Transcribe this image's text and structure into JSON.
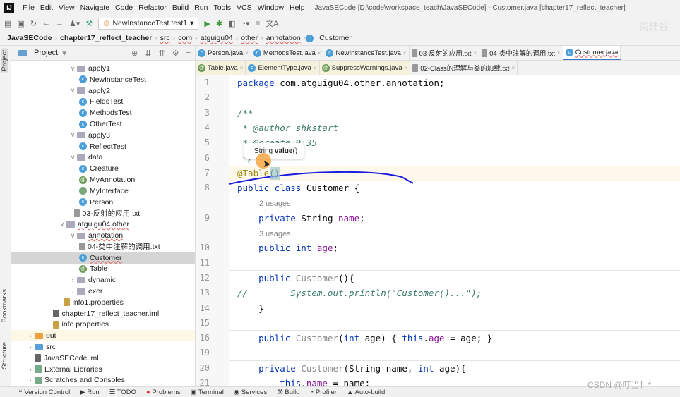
{
  "menubar": {
    "items": [
      "File",
      "Edit",
      "View",
      "Navigate",
      "Code",
      "Refactor",
      "Build",
      "Run",
      "Tools",
      "VCS",
      "Window",
      "Help"
    ],
    "title": "JavaSECode [D:\\code\\workspace_teach\\JavaSECode] - Customer.java [chapter17_reflect_teacher]"
  },
  "toolbar": {
    "run_config": "NewInstanceTest.test1"
  },
  "breadcrumb": [
    "JavaSECode",
    "chapter17_reflect_teacher",
    "src",
    "com",
    "atguigu04",
    "other",
    "annotation",
    "Customer"
  ],
  "left_strip": {
    "project": "Project",
    "bookmarks": "Bookmarks",
    "structure": "Structure"
  },
  "project": {
    "title": "Project",
    "tree": [
      {
        "label": "apply1",
        "lvl": 5,
        "type": "folder",
        "open": true
      },
      {
        "label": "NewInstanceTest",
        "lvl": 6,
        "type": "cls"
      },
      {
        "label": "apply2",
        "lvl": 5,
        "type": "folder",
        "open": true
      },
      {
        "label": "FieldsTest",
        "lvl": 6,
        "type": "cls"
      },
      {
        "label": "MethodsTest",
        "lvl": 6,
        "type": "cls"
      },
      {
        "label": "OtherTest",
        "lvl": 6,
        "type": "cls"
      },
      {
        "label": "apply3",
        "lvl": 5,
        "type": "folder",
        "open": true
      },
      {
        "label": "ReflectTest",
        "lvl": 6,
        "type": "cls"
      },
      {
        "label": "data",
        "lvl": 5,
        "type": "folder",
        "open": true
      },
      {
        "label": "Creature",
        "lvl": 6,
        "type": "cls"
      },
      {
        "label": "MyAnnotation",
        "lvl": 6,
        "type": "ann"
      },
      {
        "label": "MyInterface",
        "lvl": 6,
        "type": "itf"
      },
      {
        "label": "Person",
        "lvl": 6,
        "type": "cls"
      },
      {
        "label": "03-反射的应用.txt",
        "lvl": 5.5,
        "type": "txt"
      },
      {
        "label": "atguigu04.other",
        "lvl": 4,
        "type": "folder",
        "open": true
      },
      {
        "label": "annotation",
        "lvl": 5,
        "type": "folder",
        "open": true
      },
      {
        "label": "04-类中注解的调用.txt",
        "lvl": 6,
        "type": "txt"
      },
      {
        "label": "Customer",
        "lvl": 6,
        "type": "cls",
        "selected": true
      },
      {
        "label": "Table",
        "lvl": 6,
        "type": "ann"
      },
      {
        "label": "dynamic",
        "lvl": 5,
        "type": "folder",
        "open": false
      },
      {
        "label": "exer",
        "lvl": 5,
        "type": "folder",
        "open": false
      },
      {
        "label": "info1.properties",
        "lvl": 4.5,
        "type": "prop"
      },
      {
        "label": "chapter17_reflect_teacher.iml",
        "lvl": 3.5,
        "type": "iml"
      },
      {
        "label": "info.properties",
        "lvl": 3.5,
        "type": "prop"
      },
      {
        "label": "out",
        "lvl": 1,
        "type": "folder-o",
        "open": false,
        "hl": true
      },
      {
        "label": "src",
        "lvl": 1,
        "type": "folder-b",
        "open": false
      },
      {
        "label": "JavaSECode.iml",
        "lvl": 1.8,
        "type": "iml"
      },
      {
        "label": "External Libraries",
        "lvl": 1,
        "type": "lib",
        "open": false
      },
      {
        "label": "Scratches and Consoles",
        "lvl": 1,
        "type": "lib",
        "open": false
      }
    ]
  },
  "tabs_row1": [
    {
      "label": "Person.java",
      "icon": "cls"
    },
    {
      "label": "MethodsTest.java",
      "icon": "cls"
    },
    {
      "label": "NewInstanceTest.java",
      "icon": "cls"
    },
    {
      "label": "03-反射的应用.txt",
      "icon": "txt"
    },
    {
      "label": "04-类中注解的调用.txt",
      "icon": "txt"
    },
    {
      "label": "Customer.java",
      "icon": "cls",
      "active": true
    }
  ],
  "tabs_row2": [
    {
      "label": "Table.java",
      "icon": "ann",
      "yl": true
    },
    {
      "label": "ElementType.java",
      "icon": "cls",
      "yl": true
    },
    {
      "label": "SuppressWarnings.java",
      "icon": "ann",
      "yl": true
    },
    {
      "label": "02-Class的理解与类的加载.txt",
      "icon": "txt"
    }
  ],
  "code": [
    {
      "n": "1",
      "t": [
        [
          "package ",
          "k"
        ],
        [
          "com.atguigu04.other.annotation;",
          ""
        ]
      ]
    },
    {
      "n": "2",
      "t": []
    },
    {
      "n": "3",
      "t": [
        [
          "/**",
          "dc"
        ]
      ]
    },
    {
      "n": "4",
      "t": [
        [
          " * ",
          "dc"
        ],
        [
          "@author",
          "dc"
        ],
        [
          " shkstart",
          "dc"
        ]
      ]
    },
    {
      "n": "5",
      "t": [
        [
          " * @create 9:35",
          "dc"
        ]
      ]
    },
    {
      "n": "6",
      "t": [
        [
          " */",
          "dc"
        ]
      ]
    },
    {
      "n": "7",
      "t": [
        [
          "@Table",
          "an"
        ],
        [
          "()",
          ""
        ]
      ]
    },
    {
      "n": "8",
      "t": [
        [
          "public class ",
          "k"
        ],
        [
          "Customer {",
          ""
        ]
      ]
    },
    {
      "n": "",
      "u": "2 usages"
    },
    {
      "n": "9",
      "t": [
        [
          "    private ",
          "k"
        ],
        [
          "String ",
          ""
        ],
        [
          "name",
          "f"
        ],
        [
          ";",
          ""
        ]
      ]
    },
    {
      "n": "",
      "u": "3 usages"
    },
    {
      "n": "10",
      "t": [
        [
          "    public int ",
          "k"
        ],
        [
          "age",
          "f"
        ],
        [
          ";",
          ""
        ]
      ]
    },
    {
      "n": "11",
      "t": []
    },
    {
      "n": "12",
      "t": [
        [
          "    public ",
          "k"
        ],
        [
          "Customer",
          "gr"
        ],
        [
          "(){",
          ""
        ]
      ]
    },
    {
      "n": "13",
      "t": [
        [
          "//        System.out.println(\"Customer()...\");",
          "dc"
        ]
      ]
    },
    {
      "n": "14",
      "t": [
        [
          "    }",
          ""
        ]
      ]
    },
    {
      "n": "15",
      "t": []
    },
    {
      "n": "16",
      "t": [
        [
          "    public ",
          "k"
        ],
        [
          "Customer",
          "gr"
        ],
        [
          "(",
          ""
        ],
        [
          "int ",
          "k"
        ],
        [
          "age) { ",
          ""
        ],
        [
          "this",
          "k"
        ],
        [
          ".",
          ""
        ],
        [
          "age",
          "f"
        ],
        [
          " = age; }",
          ""
        ]
      ]
    },
    {
      "n": "19",
      "t": []
    },
    {
      "n": "20",
      "t": [
        [
          "    private ",
          "k"
        ],
        [
          "Customer",
          "gr"
        ],
        [
          "(String name, ",
          ""
        ],
        [
          "int ",
          "k"
        ],
        [
          "age){",
          ""
        ]
      ]
    },
    {
      "n": "21",
      "t": [
        [
          "        this",
          "k"
        ],
        [
          ".",
          ""
        ],
        [
          "name",
          "f"
        ],
        [
          " = name;",
          ""
        ]
      ]
    }
  ],
  "tooltip": {
    "type": "String",
    "method": "value",
    "parens": "()"
  },
  "statusbar": [
    "Version Control",
    "Run",
    "TODO",
    "Problems",
    "Terminal",
    "Services",
    "Build",
    "Profiler",
    "Auto-build"
  ],
  "watermark": "CSDN @叮当！*"
}
